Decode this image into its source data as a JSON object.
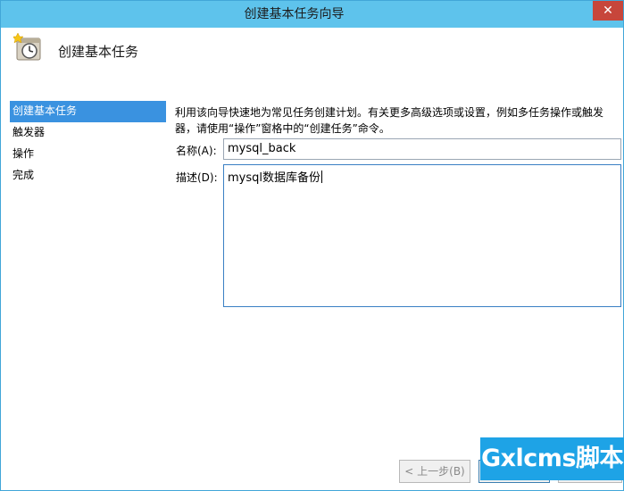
{
  "window": {
    "title": "创建基本任务向导",
    "close_label": "✕"
  },
  "header": {
    "title": "创建基本任务",
    "icon": "task-scheduler-icon"
  },
  "nav": {
    "items": [
      {
        "label": "创建基本任务",
        "selected": true
      },
      {
        "label": "触发器",
        "selected": false
      },
      {
        "label": "操作",
        "selected": false
      },
      {
        "label": "完成",
        "selected": false
      }
    ]
  },
  "content": {
    "intro_line1": "利用该向导快速地为常见任务创建计划。有关更多高级选项或设置，例如多任务操作或触发",
    "intro_line2": "器，请使用“操作”窗格中的“创建任务”命令。",
    "name_label": "名称(A):",
    "name_value": "mysql_back",
    "desc_label": "描述(D):",
    "desc_value": "mysql数据库备份"
  },
  "buttons": {
    "prev_label": "< 上一步(B)",
    "next_label": "",
    "cancel_label": ""
  },
  "watermark": {
    "text": "Gxlcms脚本"
  },
  "colors": {
    "titlebar": "#5ec3ec",
    "selected": "#3a92e0",
    "close": "#c7463b",
    "watermark": "#1ea3e6"
  }
}
